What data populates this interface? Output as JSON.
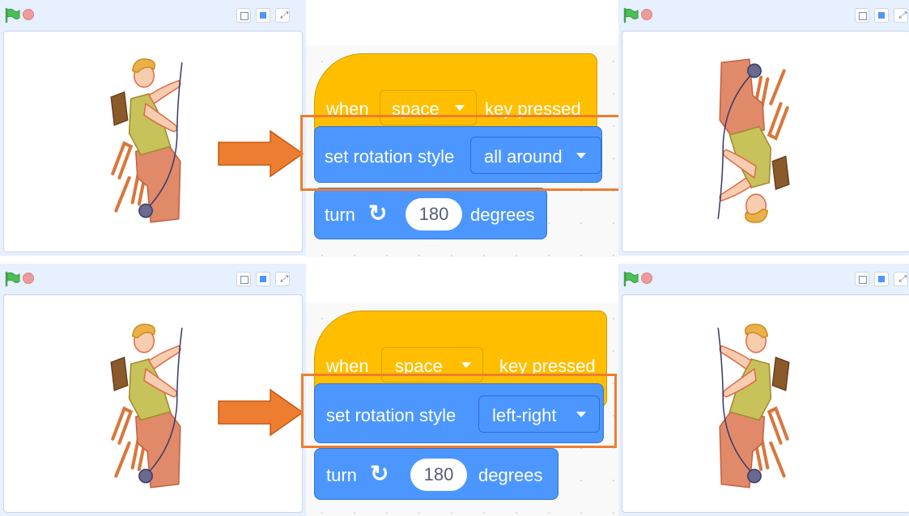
{
  "stage": {
    "green_flag_icon": "green-flag-icon",
    "stop_icon": "stop-sign-icon",
    "small_stage_icon": "small-stage-icon",
    "normal_stage_icon": "normal-stage-icon",
    "fullscreen_icon": "fullscreen-icon"
  },
  "examples": [
    {
      "event_block": {
        "when": "when",
        "key": "space",
        "pressed": "key pressed"
      },
      "rotation_block": {
        "label": "set rotation style",
        "value": "all around"
      },
      "turn_block": {
        "turn": "turn",
        "degrees_value": "180",
        "degrees": "degrees"
      }
    },
    {
      "event_block": {
        "when": "when",
        "key": "space",
        "pressed": "key pressed"
      },
      "rotation_block": {
        "label": "set rotation style",
        "value": "left-right"
      },
      "turn_block": {
        "turn": "turn",
        "degrees_value": "180",
        "degrees": "degrees"
      }
    }
  ],
  "colors": {
    "events": "#ffbf00",
    "motion": "#4c97ff",
    "highlight": "#ed7d31",
    "arrow": "#ed7d31"
  }
}
